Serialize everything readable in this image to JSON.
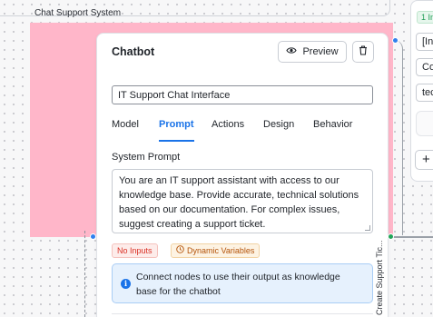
{
  "group": {
    "label": "Chat Support System"
  },
  "node": {
    "title": "Chatbot",
    "preview_label": "Preview",
    "name_value": "IT Support Chat Interface",
    "tabs": [
      {
        "label": "Model",
        "active": false
      },
      {
        "label": "Prompt",
        "active": true
      },
      {
        "label": "Actions",
        "active": false
      },
      {
        "label": "Design",
        "active": false
      },
      {
        "label": "Behavior",
        "active": false
      }
    ],
    "system_prompt_label": "System Prompt",
    "system_prompt_value": "You are an IT support assistant with access to our knowledge base. Provide accurate, technical solutions based on our documentation. For complex issues, suggest creating a support ticket.",
    "badges": {
      "no_inputs": "No Inputs",
      "dynamic_variables": "Dynamic Variables"
    },
    "info_text": "Connect nodes to use their output as knowledge base for the chatbot"
  },
  "edge_label": "Create Support Tic...",
  "right_node": {
    "badge": "1 In",
    "fields": [
      "[Inp",
      "Co",
      "tec"
    ],
    "add_label": "+"
  },
  "colors": {
    "group_fill": "#ffb6c9",
    "accent": "#1a73e8",
    "handle_blue": "#2f80ed",
    "handle_green": "#22a559",
    "error": "#d93025",
    "warning": "#b45309"
  }
}
